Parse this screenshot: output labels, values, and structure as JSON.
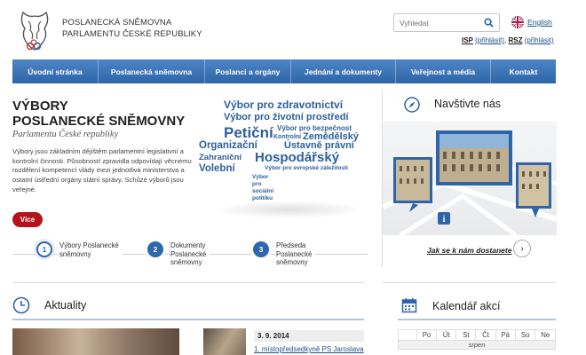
{
  "header": {
    "brand_line1": "POSLANECKÁ SNĚMOVNA",
    "brand_line2": "PARLAMENTU ČESKÉ REPUBLIKY",
    "search_placeholder": "Vyhledat",
    "lang_label": "English",
    "login_isp": "ISP",
    "login_isp_action": "(přihlásit)",
    "login_sep": ",",
    "login_rsz": "RSZ",
    "login_rsz_action": "(přihlásit)"
  },
  "nav": {
    "items": [
      {
        "label": "Úvodní stránka"
      },
      {
        "label": "Poslanecká sněmovna"
      },
      {
        "label": "Poslanci a orgány"
      },
      {
        "label": "Jednání a dokumenty"
      },
      {
        "label": "Veřejnost a média"
      },
      {
        "label": "Kontakt"
      }
    ]
  },
  "hero": {
    "title_line1": "VÝBORY",
    "title_line2": "POSLANECKÉ SNĚMOVNY",
    "subtitle": "Parlamentu České republiky",
    "text": "Výbory jsou základním dějištěm parlamentní legislativní a kontrolní činnosti. Působností zpravidla odpovídají věcnému rozdělení kompetencí vlády mezi jednotlivá ministerstva a ostatní ústřední orgány státní správy. Schůze výborů jsou veřejné.",
    "more_label": "Více"
  },
  "cloud": {
    "w1": "Výbor pro zdravotnictví",
    "w2": "Výbor pro životní prostředí",
    "w3": "Petiční",
    "w4": "Výbor pro bezpečnost",
    "w5": "Kontrolní",
    "w6": "Zemědělský",
    "w7": "Organizační",
    "w8": "Ústavně právní",
    "w9": "Zahraniční",
    "w10": "Hospodářský",
    "w11": "Volební",
    "w12": "Výbor pro evropské záležitosti",
    "w13": "Výbor pro sociální politiku"
  },
  "steps": [
    {
      "num": "1",
      "l1": "Výbory Poslanecké",
      "l2": "sněmovny"
    },
    {
      "num": "2",
      "l1": "Dokumenty",
      "l2": "Poslanecké",
      "l3": "sněmovny"
    },
    {
      "num": "3",
      "l1": "Předseda",
      "l2": "Poslanecké",
      "l3": "sněmovny"
    }
  ],
  "visit": {
    "title": "Navštivte nás",
    "link": "Jak se k nám dostanete",
    "arrow": "›"
  },
  "news": {
    "title": "Aktuality",
    "date": "3. 9. 2014",
    "link": "1. místopředsedkyně PS Jaroslava"
  },
  "calendar": {
    "title": "Kalendář akcí",
    "days": [
      "Po",
      "Út",
      "St",
      "Čt",
      "Pá",
      "So",
      "Ne"
    ],
    "month": "srpen"
  },
  "colors": {
    "nav": "#2e64a8",
    "accent_red": "#b3141b",
    "link": "#1a4f8a"
  }
}
